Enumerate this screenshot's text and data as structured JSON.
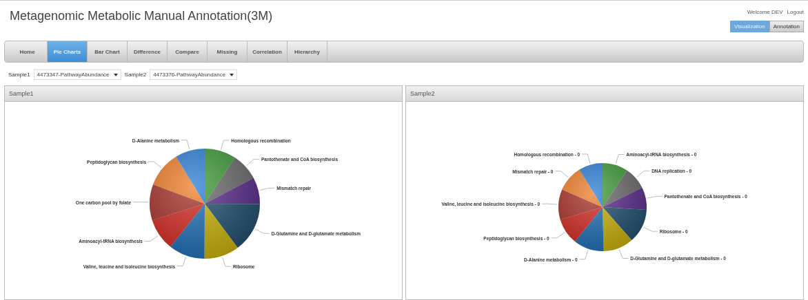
{
  "header": {
    "title": "Metagenomic Metabolic Manual Annotation(3M)",
    "welcome": "Welcome DEV",
    "logout": "Logout",
    "modes": [
      {
        "label": "Visualization",
        "selected": true
      },
      {
        "label": "Annotation",
        "selected": false
      }
    ]
  },
  "tabs": [
    {
      "label": "Home",
      "selected": false
    },
    {
      "label": "Pie Charts",
      "selected": true
    },
    {
      "label": "Bar Chart",
      "selected": false
    },
    {
      "label": "Difference",
      "selected": false
    },
    {
      "label": "Compare",
      "selected": false
    },
    {
      "label": "Missing",
      "selected": false
    },
    {
      "label": "Correlation",
      "selected": false
    },
    {
      "label": "Hierarchy",
      "selected": false
    }
  ],
  "selectors": [
    {
      "label": "Sample1",
      "value": "4473347-PathwayAbundance"
    },
    {
      "label": "Sample2",
      "value": "4473376-PathwayAbundance"
    }
  ],
  "panels": [
    {
      "title": "Sample1",
      "chart_data": {
        "type": "pie",
        "categories": [
          "Homologous recombination",
          "Pantothenate and CoA biosynthesis",
          "Mismatch repair",
          "D-Glutamine and D-glutamate metabolism",
          "Ribosome",
          "Valine, leucine and isoleucine biosynthesis",
          "Aminoacyl-tRNA biosynthesis",
          "One carbon pool by folate",
          "Peptidoglycan biosynthesis",
          "D-Alanine metabolism"
        ],
        "values": [
          9.2,
          8.1,
          7.8,
          14.7,
          10.3,
          10.6,
          9.4,
          10.6,
          10.6,
          8.7
        ]
      }
    },
    {
      "title": "Sample2",
      "chart_data": {
        "type": "pie",
        "categories": [
          "Aminoacyl-tRNA biosynthesis - 0",
          "DNA replication - 0",
          "Pantothenate and CoA biosynthesis - 0",
          "Ribosome - 0",
          "D-Glutamine and D-glutamate metabolism - 0",
          "D-Alanine metabolism - 0",
          "Peptidoglycan biosynthesis - 0",
          "Valine, leucine and isoleucine biosynthesis - 0",
          "Mismatch repair - 0",
          "Homologous recombination - 0"
        ],
        "values": [
          9.4,
          8.3,
          8.3,
          12.5,
          11.1,
          11.1,
          9.7,
          11.1,
          9.7,
          8.8
        ]
      }
    }
  ]
}
